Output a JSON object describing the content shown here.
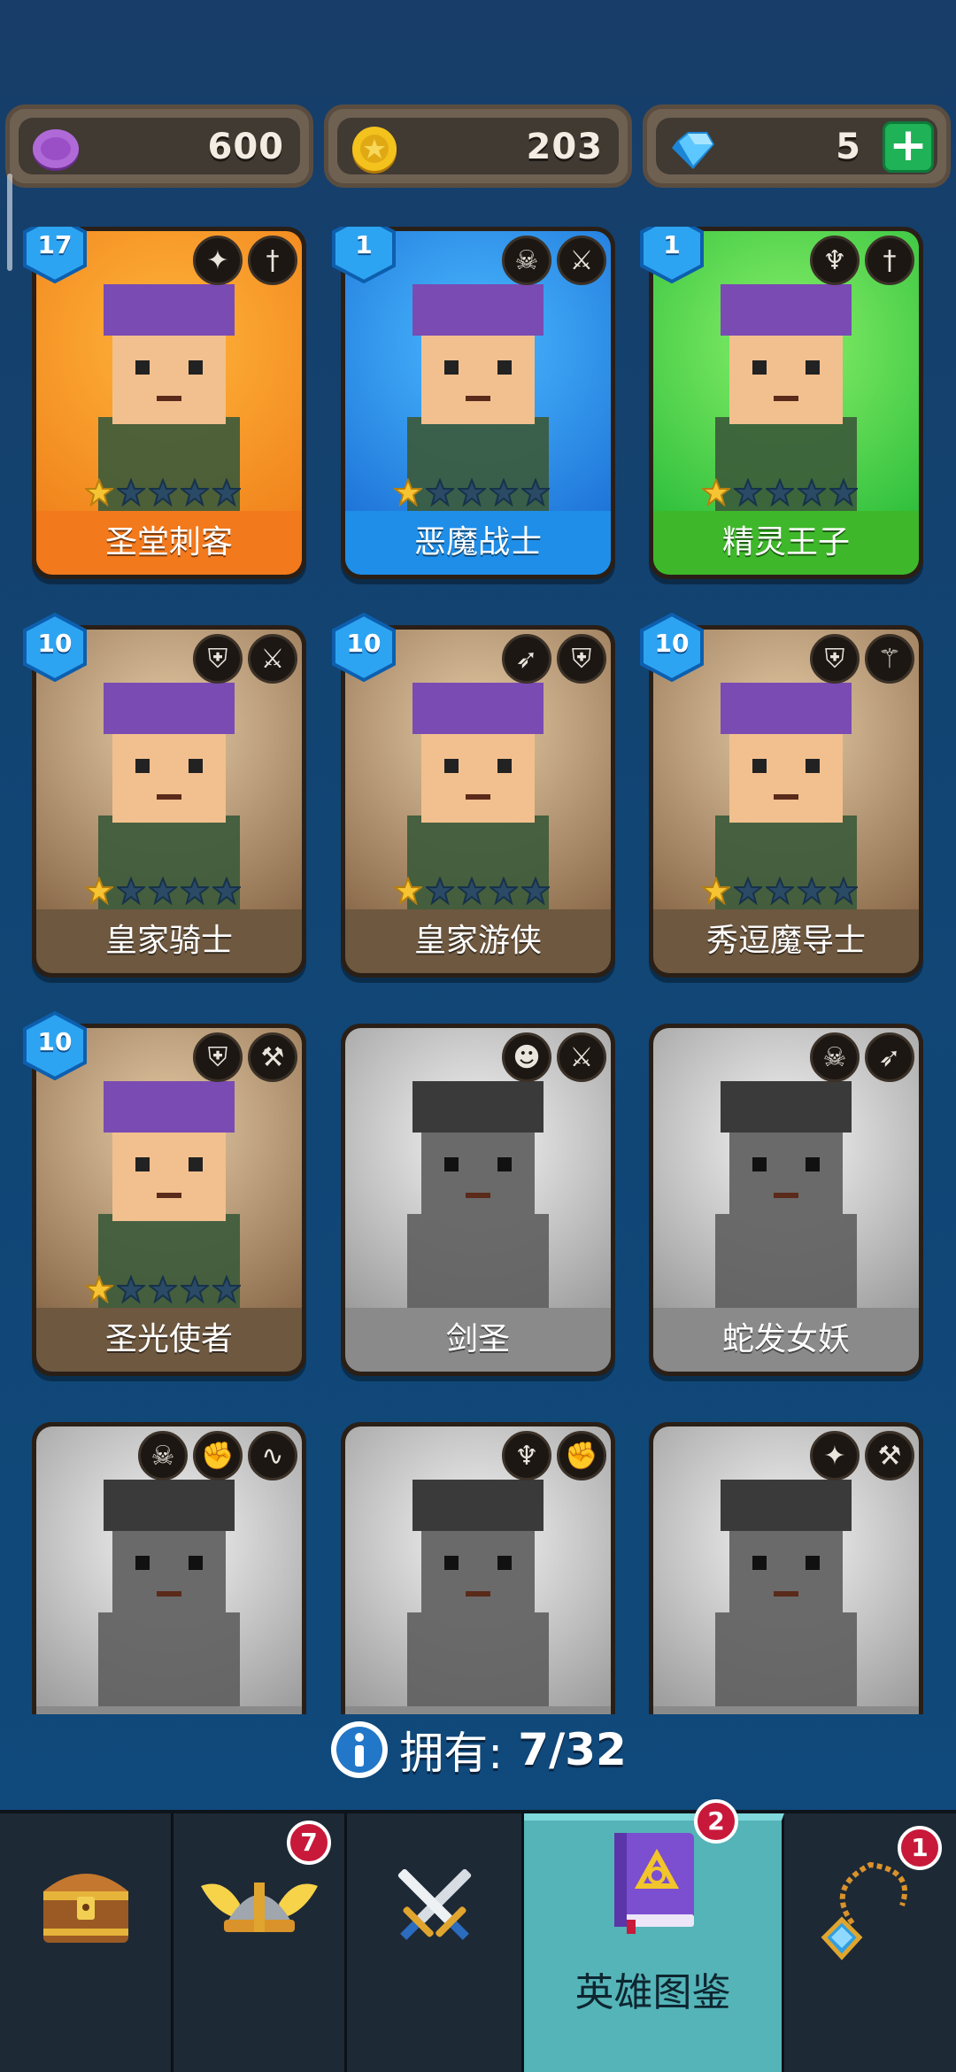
{
  "currencies": [
    {
      "name": "purple-coin",
      "value": "600",
      "color": "#a35ad1"
    },
    {
      "name": "gold-coin",
      "value": "203",
      "color": "#f3c21d"
    },
    {
      "name": "diamond",
      "value": "5",
      "color": "#37b2f0",
      "has_plus": true
    }
  ],
  "heroes": [
    {
      "name": "圣堂刺客",
      "level": "17",
      "stars": 1,
      "theme": "orange",
      "badges": [
        "winged-emblem-icon",
        "dagger-icon"
      ]
    },
    {
      "name": "恶魔战士",
      "level": "1",
      "stars": 1,
      "theme": "blue",
      "badges": [
        "demon-skull-icon",
        "sword-icon"
      ]
    },
    {
      "name": "精灵王子",
      "level": "1",
      "stars": 1,
      "theme": "green",
      "badges": [
        "elf-icon",
        "dagger-icon"
      ]
    },
    {
      "name": "皇家骑士",
      "level": "10",
      "stars": 1,
      "theme": "tan",
      "badges": [
        "helmet-icon",
        "sword-icon"
      ]
    },
    {
      "name": "皇家游侠",
      "level": "10",
      "stars": 1,
      "theme": "tan",
      "badges": [
        "bow-icon",
        "helmet-icon"
      ]
    },
    {
      "name": "秀逗魔导士",
      "level": "10",
      "stars": 1,
      "theme": "tan",
      "badges": [
        "helmet-icon",
        "staff-icon"
      ]
    },
    {
      "name": "圣光使者",
      "level": "10",
      "stars": 1,
      "theme": "tan",
      "badges": [
        "helmet-icon",
        "hammer-icon"
      ]
    },
    {
      "name": "剑圣",
      "level": "",
      "stars": 0,
      "theme": "gray",
      "badges": [
        "orc-icon",
        "sword-icon"
      ]
    },
    {
      "name": "蛇发女妖",
      "level": "",
      "stars": 0,
      "theme": "gray",
      "badges": [
        "demon-skull-icon",
        "bow-icon"
      ]
    },
    {
      "name": "",
      "level": "",
      "stars": 0,
      "theme": "gray",
      "badges": [
        "demon-skull-icon",
        "fist-icon",
        "dragon-icon"
      ]
    },
    {
      "name": "",
      "level": "",
      "stars": 0,
      "theme": "gray",
      "badges": [
        "elf-icon",
        "fist-icon"
      ]
    },
    {
      "name": "",
      "level": "",
      "stars": 0,
      "theme": "gray",
      "badges": [
        "winged-emblem-icon",
        "hammer-icon"
      ]
    }
  ],
  "owned": {
    "label": "拥有:",
    "count": "7/32"
  },
  "nav": {
    "items": [
      {
        "id": "chest",
        "label": "",
        "badge": ""
      },
      {
        "id": "heroes-helmet",
        "label": "",
        "badge": "7"
      },
      {
        "id": "battle",
        "label": "",
        "badge": ""
      },
      {
        "id": "codex",
        "label": "英雄图鉴",
        "badge": "2",
        "active": true
      },
      {
        "id": "amulet",
        "label": "",
        "badge": "1"
      }
    ]
  }
}
